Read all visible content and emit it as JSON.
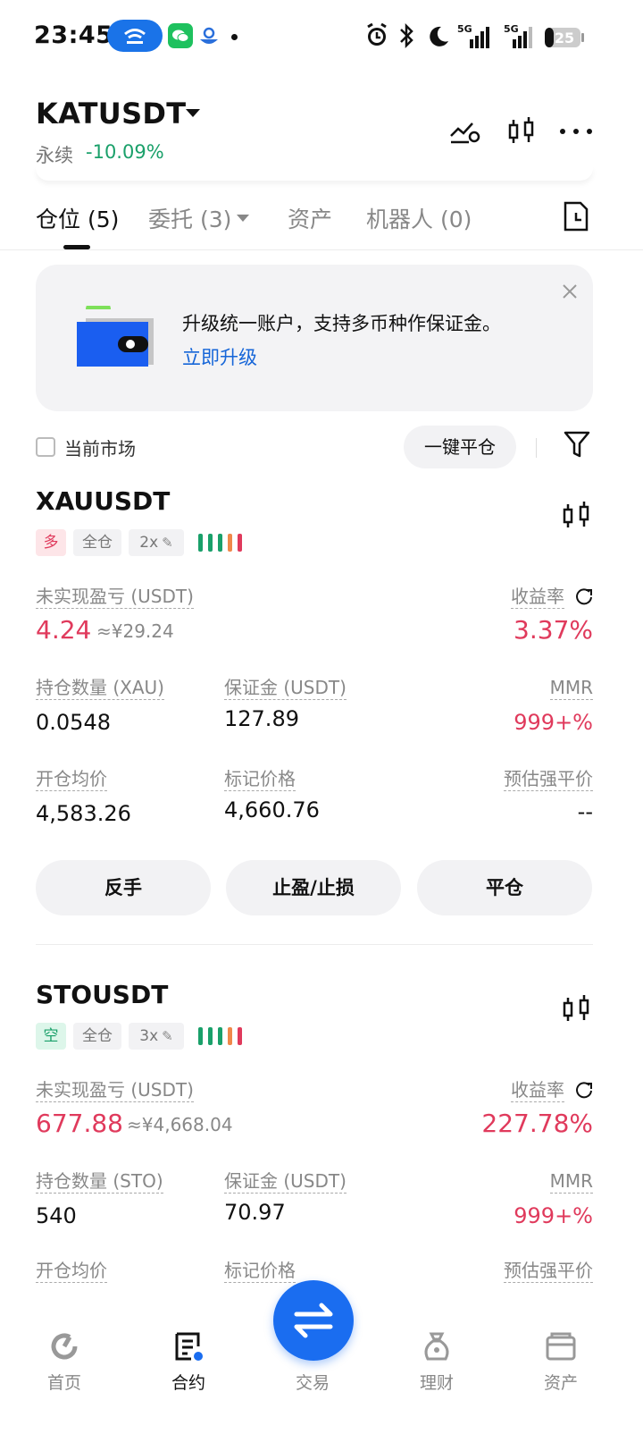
{
  "status_bar": {
    "time": "23:45",
    "battery": "25",
    "network_1": "5G",
    "network_2": "5G",
    "icons": [
      "hotspot-icon",
      "wechat-icon",
      "app-icon",
      "alarm-icon",
      "bluetooth-icon",
      "moon-icon",
      "signal-icon",
      "battery-icon"
    ]
  },
  "header": {
    "pair": "KATUSDT",
    "contract_type": "永续",
    "change": "-10.09%",
    "icons": [
      "chart-settings-icon",
      "candlestick-icon",
      "more-icon"
    ]
  },
  "tabs": [
    {
      "label": "仓位 (5)",
      "active": true
    },
    {
      "label": "委托 (3)",
      "active": false
    },
    {
      "label": "资产",
      "active": false
    },
    {
      "label": "机器人 (0)",
      "active": false
    }
  ],
  "promo": {
    "text": "升级统一账户，支持多币种作保证金。",
    "link": "立即升级"
  },
  "filter": {
    "current_market": "当前市场",
    "close_all": "一键平仓"
  },
  "positions": [
    {
      "symbol": "XAUUSDT",
      "side": "多",
      "margin_mode": "全仓",
      "leverage": "2x",
      "unrealized_label": "未实现盈亏 (USDT)",
      "unrealized": "4.24",
      "unrealized_cny": "≈¥29.24",
      "roe_label": "收益率",
      "roe": "3.37%",
      "qty_label": "持仓数量 (XAU)",
      "qty": "0.0548",
      "margin_label": "保证金 (USDT)",
      "margin": "127.89",
      "mmr_label": "MMR",
      "mmr": "999+%",
      "entry_label": "开仓均价",
      "entry": "4,583.26",
      "mark_label": "标记价格",
      "mark": "4,660.76",
      "liq_label": "预估强平价",
      "liq": "--",
      "actions": [
        "反手",
        "止盈/止损",
        "平仓"
      ]
    },
    {
      "symbol": "STOUSDT",
      "side": "空",
      "margin_mode": "全仓",
      "leverage": "3x",
      "unrealized_label": "未实现盈亏 (USDT)",
      "unrealized": "677.88",
      "unrealized_cny": "≈¥4,668.04",
      "roe_label": "收益率",
      "roe": "227.78%",
      "qty_label": "持仓数量 (STO)",
      "qty": "540",
      "margin_label": "保证金 (USDT)",
      "margin": "70.97",
      "mmr_label": "MMR",
      "mmr": "999+%",
      "entry_label": "开仓均价",
      "mark_label": "标记价格",
      "liq_label": "预估强平价"
    }
  ],
  "bottom_nav": [
    {
      "label": "首页",
      "icon": "home-icon",
      "active": false
    },
    {
      "label": "合约",
      "icon": "contract-icon",
      "active": true
    },
    {
      "label": "交易",
      "icon": "trade-swap-icon",
      "active": false
    },
    {
      "label": "理财",
      "icon": "finance-icon",
      "active": false
    },
    {
      "label": "资产",
      "icon": "wallet-icon",
      "active": false
    }
  ],
  "colors": {
    "red": "#e03a5c",
    "green": "#1aa06a",
    "blue": "#1a6df0",
    "link": "#1565d8"
  }
}
